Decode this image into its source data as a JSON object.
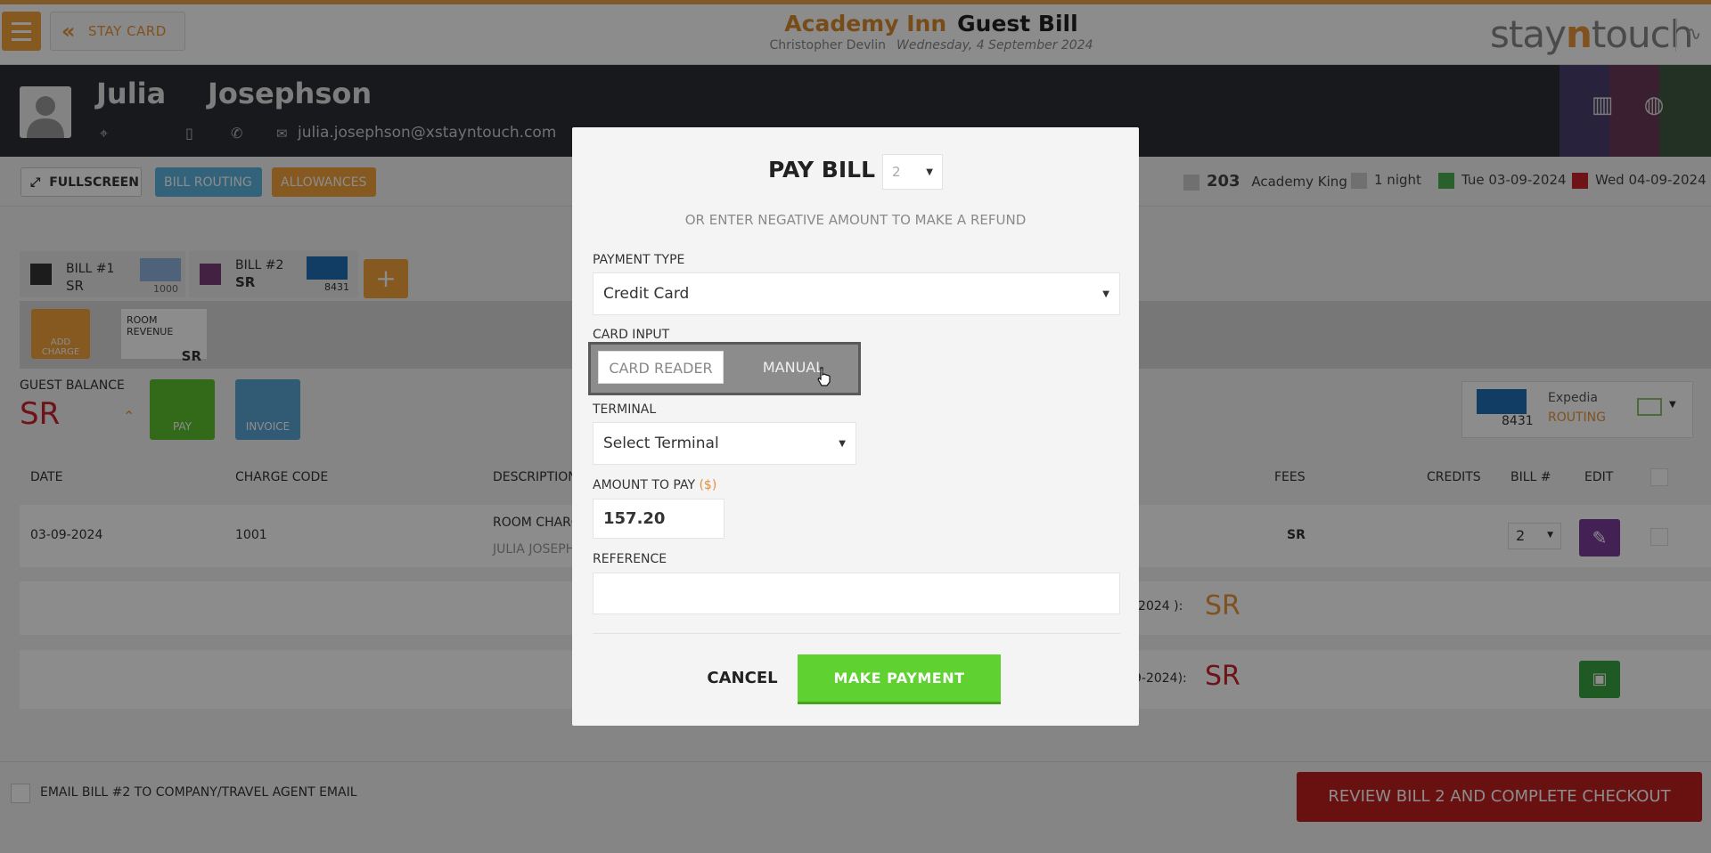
{
  "header": {
    "staycard_label": "STAY CARD",
    "hotel": "Academy Inn",
    "page": "Guest Bill",
    "user": "Christopher Devlin",
    "date": "Wednesday, 4 September 2024",
    "brand_pre": "stay",
    "brand_n": "n",
    "brand_post": "touch"
  },
  "guest": {
    "first_name": "Julia",
    "last_name": "Josephson",
    "email": "julia.josephson@xstayntouch.com"
  },
  "actions": {
    "fullscreen": "FULLSCREEN",
    "bill_routing": "BILL ROUTING",
    "allowances": "ALLOWANCES"
  },
  "stay": {
    "room": "203",
    "room_type": "Academy King",
    "nights": "1 night",
    "arrival": "Tue 03-09-2024",
    "departure": "Wed 04-09-2024"
  },
  "bills": [
    {
      "label": "BILL #1",
      "amount": "SR",
      "card_last4": "1000"
    },
    {
      "label": "BILL #2",
      "amount": "SR",
      "card_last4": "8431"
    }
  ],
  "add_bill": "+",
  "add_charge": "ADD CHARGE",
  "room_revenue": {
    "label": "ROOM REVENUE",
    "value": "SR"
  },
  "guest_balance": {
    "label": "GUEST BALANCE",
    "value": "SR"
  },
  "pay_label": "PAY",
  "invoice_label": "INVOICE",
  "routing_card": {
    "card_last4": "8431",
    "name": "Expedia",
    "status": "ROUTING"
  },
  "table": {
    "headers": [
      "DATE",
      "CHARGE CODE",
      "DESCRIPTION",
      "FEES",
      "CREDITS",
      "BILL #",
      "EDIT"
    ],
    "row": {
      "date": "03-09-2024",
      "code": "1001",
      "desc": "ROOM CHARG",
      "desc_sub": "JULIA JOSEPH",
      "fees": "SR",
      "bill": "2"
    },
    "total1_tail": "-2024 ):",
    "total1_val": "SR",
    "total2_tail": "9-2024):",
    "total2_val": "SR"
  },
  "footer": {
    "email_label": "EMAIL BILL #2 TO COMPANY/TRAVEL AGENT EMAIL",
    "review_label": "REVIEW BILL 2 AND COMPLETE CHECKOUT"
  },
  "modal": {
    "title": "PAY BILL #",
    "bill_number": "2",
    "refund_note": "OR ENTER NEGATIVE AMOUNT TO MAKE A REFUND",
    "payment_type_label": "PAYMENT TYPE",
    "payment_type_value": "Credit Card",
    "card_input_label": "CARD INPUT",
    "card_reader": "CARD READER",
    "manual": "MANUAL",
    "terminal_label": "TERMINAL",
    "terminal_value": "Select Terminal",
    "amount_label": "AMOUNT TO PAY",
    "amount_currency": "($)",
    "amount_value": "157.20",
    "reference_label": "REFERENCE",
    "reference_value": "",
    "cancel": "CANCEL",
    "submit": "MAKE PAYMENT"
  },
  "colors": {
    "accent_orange": "#f2a23a",
    "balance_red": "#c8232c",
    "pay_green": "#5fd131",
    "review_red": "#c0201f"
  }
}
